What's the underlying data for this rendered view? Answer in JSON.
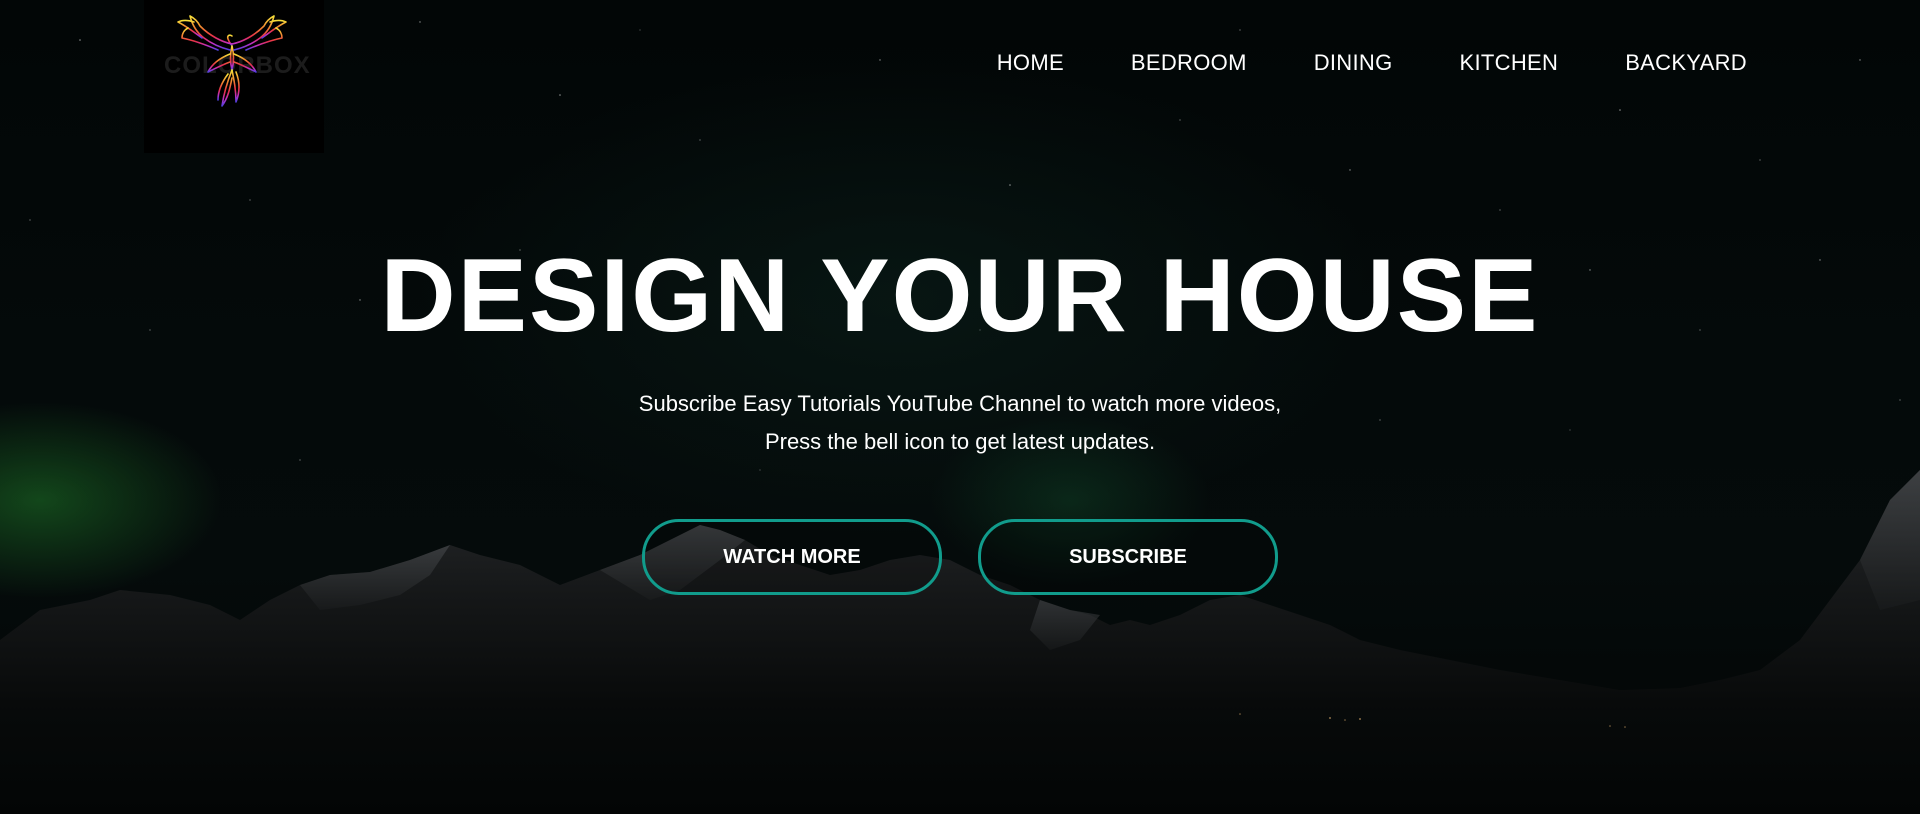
{
  "logo": {
    "text": "COLORBOX",
    "icon": "phoenix-logo-icon"
  },
  "nav": {
    "items": [
      {
        "label": "HOME"
      },
      {
        "label": "BEDROOM"
      },
      {
        "label": "DINING"
      },
      {
        "label": "KITCHEN"
      },
      {
        "label": "BACKYARD"
      }
    ]
  },
  "hero": {
    "headline": "DESIGN YOUR HOUSE",
    "subtitle_line1": "Subscribe Easy Tutorials YouTube Channel to watch more videos,",
    "subtitle_line2": "Press the bell icon to get latest updates."
  },
  "buttons": {
    "watch_more": "WATCH MORE",
    "subscribe": "SUBSCRIBE"
  },
  "colors": {
    "accent": "#119c8c",
    "background": "#040808",
    "text": "#ffffff"
  }
}
